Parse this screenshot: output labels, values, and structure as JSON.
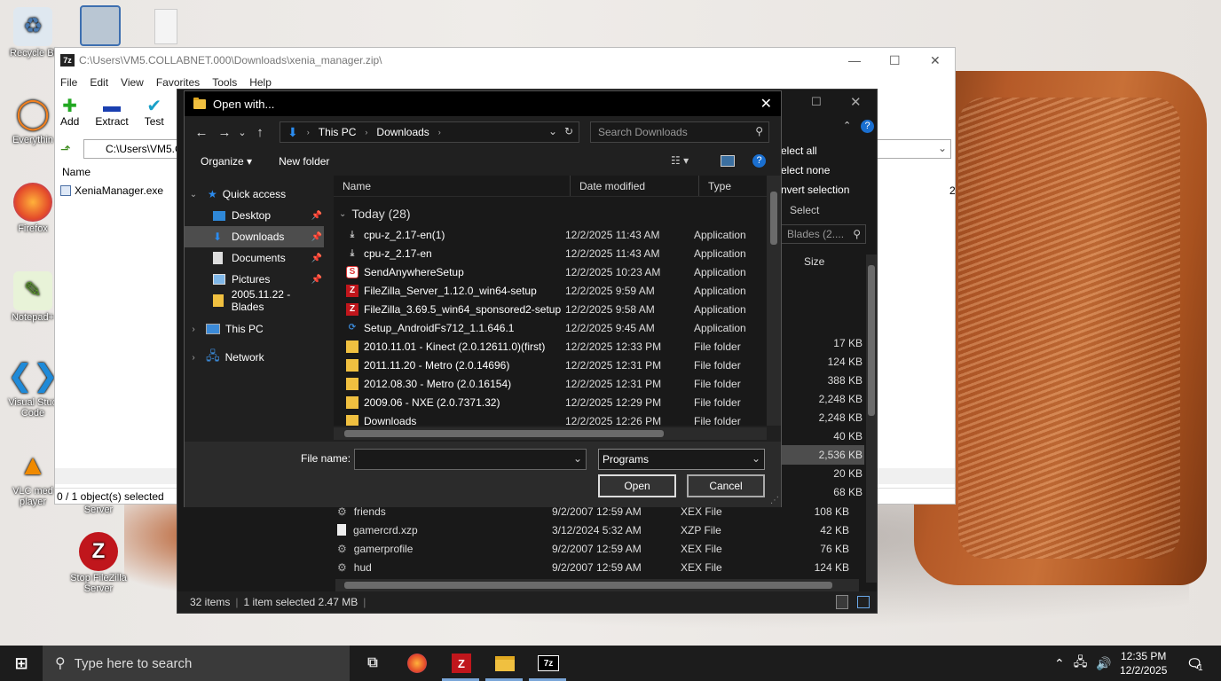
{
  "desktop": {
    "icons": [
      {
        "label": "Recycle Bi"
      },
      {
        "label": "Everythin"
      },
      {
        "label": "Firefox"
      },
      {
        "label": "Notepad+"
      },
      {
        "label": "Visual Stud Code"
      },
      {
        "label": "VLC med player"
      },
      {
        "label": "Server"
      },
      {
        "label": "Stop FileZilla Server"
      }
    ]
  },
  "zip": {
    "title": "C:\\Users\\VM5.COLLABNET.000\\Downloads\\xenia_manager.zip\\",
    "menu": [
      "File",
      "Edit",
      "View",
      "Favorites",
      "Tools",
      "Help"
    ],
    "toolbar": [
      "Add",
      "Extract",
      "Test"
    ],
    "address": "C:\\Users\\VM5.C",
    "col_name": "Name",
    "file": "XeniaManager.exe",
    "right_digit": "2",
    "status": "0 / 1 object(s) selected"
  },
  "dark": {
    "ribbon": [
      "elect all",
      "elect none",
      "nvert selection",
      "Select"
    ],
    "search": "Blades (2....",
    "col_size": "Size",
    "sizes": [
      "17 KB",
      "124 KB",
      "388 KB",
      "2,248 KB",
      "2,248 KB",
      "40 KB",
      "2,536 KB",
      "20 KB",
      "68 KB"
    ],
    "rows": [
      {
        "name": "friends",
        "date": "9/2/2007 12:59 AM",
        "type": "XEX File",
        "size": "108 KB"
      },
      {
        "name": "gamercrd.xzp",
        "date": "3/12/2024 5:32 AM",
        "type": "XZP File",
        "size": "42 KB"
      },
      {
        "name": "gamerprofile",
        "date": "9/2/2007 12:59 AM",
        "type": "XEX File",
        "size": "76 KB"
      },
      {
        "name": "hud",
        "date": "9/2/2007 12:59 AM",
        "type": "XEX File",
        "size": "124 KB"
      }
    ],
    "status_items": "32 items",
    "status_selected": "1 item selected  2.47 MB"
  },
  "dialog": {
    "title": "Open with...",
    "breadcrumb": [
      "This PC",
      "Downloads"
    ],
    "search_placeholder": "Search Downloads",
    "organize": "Organize",
    "new_folder": "New folder",
    "nav": [
      {
        "label": "Quick access",
        "type": "root"
      },
      {
        "label": "Desktop",
        "type": "child"
      },
      {
        "label": "Downloads",
        "type": "child"
      },
      {
        "label": "Documents",
        "type": "child"
      },
      {
        "label": "Pictures",
        "type": "child"
      },
      {
        "label": "2005.11.22 - Blades",
        "type": "child"
      },
      {
        "label": "This PC",
        "type": "root"
      },
      {
        "label": "Network",
        "type": "root"
      }
    ],
    "columns": [
      "Name",
      "Date modified",
      "Type"
    ],
    "group": "Today (28)",
    "files": [
      {
        "name": "cpu-z_2.17-en(1)",
        "date": "12/2/2025 11:43 AM",
        "type": "Application",
        "icon": "installer"
      },
      {
        "name": "cpu-z_2.17-en",
        "date": "12/2/2025 11:43 AM",
        "type": "Application",
        "icon": "installer"
      },
      {
        "name": "SendAnywhereSetup",
        "date": "12/2/2025 10:23 AM",
        "type": "Application",
        "icon": "sendanywhere"
      },
      {
        "name": "FileZilla_Server_1.12.0_win64-setup",
        "date": "12/2/2025 9:59 AM",
        "type": "Application",
        "icon": "filezilla"
      },
      {
        "name": "FileZilla_3.69.5_win64_sponsored2-setup",
        "date": "12/2/2025 9:58 AM",
        "type": "Application",
        "icon": "filezilla"
      },
      {
        "name": "Setup_AndroidFs712_1.1.646.1",
        "date": "12/2/2025 9:45 AM",
        "type": "Application",
        "icon": "setup"
      },
      {
        "name": "2010.11.01 - Kinect (2.0.12611.0)(first)",
        "date": "12/2/2025 12:33 PM",
        "type": "File folder",
        "icon": "folder"
      },
      {
        "name": "2011.11.20 - Metro (2.0.14696)",
        "date": "12/2/2025 12:31 PM",
        "type": "File folder",
        "icon": "folder"
      },
      {
        "name": "2012.08.30 - Metro (2.0.16154)",
        "date": "12/2/2025 12:31 PM",
        "type": "File folder",
        "icon": "folder"
      },
      {
        "name": "2009.06 - NXE (2.0.7371.32)",
        "date": "12/2/2025 12:29 PM",
        "type": "File folder",
        "icon": "folder"
      },
      {
        "name": "Downloads",
        "date": "12/2/2025 12:26 PM",
        "type": "File folder",
        "icon": "folder"
      }
    ],
    "filename_label": "File name:",
    "filename_value": "",
    "filter": "Programs",
    "open": "Open",
    "cancel": "Cancel"
  },
  "taskbar": {
    "search_placeholder": "Type here to search",
    "time": "12:35 PM",
    "date": "12/2/2025",
    "notif_count": "1"
  }
}
